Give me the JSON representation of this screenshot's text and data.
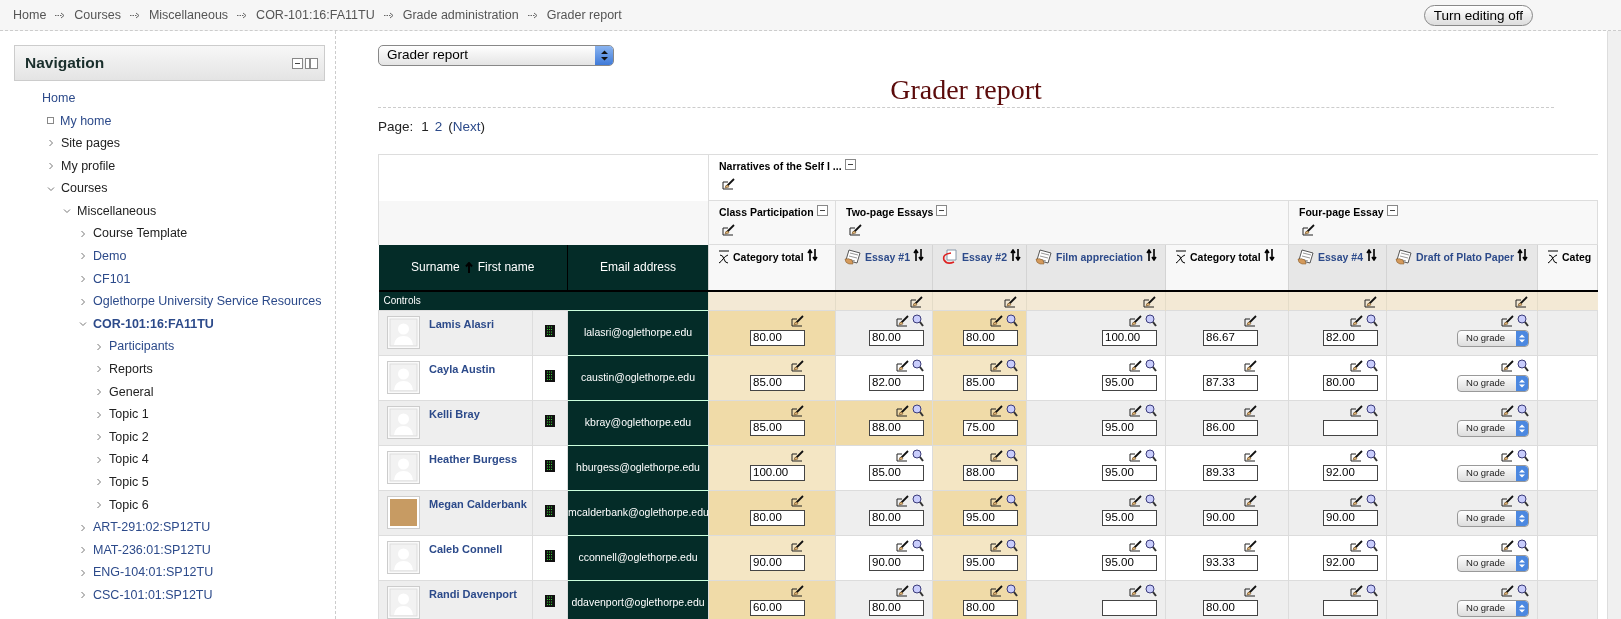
{
  "breadcrumb": [
    "Home",
    "Courses",
    "Miscellaneous",
    "COR-101:16:FA11TU",
    "Grade administration",
    "Grader report"
  ],
  "edit_button": "Turn editing off",
  "nav": {
    "title": "Navigation",
    "items": [
      {
        "label": "Home",
        "kind": "root",
        "link": true,
        "current": false
      },
      {
        "label": "My home",
        "kind": "leaf",
        "link": true,
        "current": false
      },
      {
        "label": "Site pages",
        "kind": "branch",
        "link": false,
        "current": false,
        "expanded": false
      },
      {
        "label": "My profile",
        "kind": "branch",
        "link": false,
        "current": false,
        "expanded": false
      },
      {
        "label": "Courses",
        "kind": "branch",
        "link": false,
        "current": false,
        "expanded": true,
        "children": [
          {
            "label": "Miscellaneous",
            "kind": "branch",
            "link": false,
            "current": false,
            "expanded": true,
            "children": [
              {
                "label": "Course Template",
                "kind": "branch",
                "link": false,
                "current": false,
                "expanded": false
              },
              {
                "label": "Demo",
                "kind": "branch",
                "link": true,
                "current": false,
                "expanded": false
              },
              {
                "label": "CF101",
                "kind": "branch",
                "link": true,
                "current": false,
                "expanded": false
              },
              {
                "label": "Oglethorpe University Service Resources",
                "kind": "branch",
                "link": true,
                "current": false,
                "expanded": false
              },
              {
                "label": "COR-101:16:FA11TU",
                "kind": "branch",
                "link": true,
                "current": true,
                "expanded": true,
                "children": [
                  {
                    "label": "Participants",
                    "kind": "branch",
                    "link": true,
                    "current": false,
                    "expanded": false
                  },
                  {
                    "label": "Reports",
                    "kind": "branch",
                    "link": false,
                    "current": false,
                    "expanded": false
                  },
                  {
                    "label": "General",
                    "kind": "branch",
                    "link": false,
                    "current": false,
                    "expanded": false
                  },
                  {
                    "label": "Topic 1",
                    "kind": "branch",
                    "link": false,
                    "current": false,
                    "expanded": false
                  },
                  {
                    "label": "Topic 2",
                    "kind": "branch",
                    "link": false,
                    "current": false,
                    "expanded": false
                  },
                  {
                    "label": "Topic 4",
                    "kind": "branch",
                    "link": false,
                    "current": false,
                    "expanded": false
                  },
                  {
                    "label": "Topic 5",
                    "kind": "branch",
                    "link": false,
                    "current": false,
                    "expanded": false
                  },
                  {
                    "label": "Topic 6",
                    "kind": "branch",
                    "link": false,
                    "current": false,
                    "expanded": false
                  }
                ]
              },
              {
                "label": "ART-291:02:SP12TU",
                "kind": "branch",
                "link": true,
                "current": false,
                "expanded": false
              },
              {
                "label": "MAT-236:01:SP12TU",
                "kind": "branch",
                "link": true,
                "current": false,
                "expanded": false
              },
              {
                "label": "ENG-104:01:SP12TU",
                "kind": "branch",
                "link": true,
                "current": false,
                "expanded": false
              },
              {
                "label": "CSC-101:01:SP12TU",
                "kind": "branch",
                "link": true,
                "current": false,
                "expanded": false
              }
            ]
          }
        ]
      }
    ]
  },
  "report_select": "Grader report",
  "title": "Grader report",
  "pager": {
    "label": "Page:",
    "pages": [
      {
        "label": "1",
        "selected": true
      },
      {
        "label": "2",
        "selected": false
      }
    ],
    "open": "(",
    "next": "Next",
    "close": ")"
  },
  "grader": {
    "category": "Narratives of the Self I ...",
    "surname": "Surname",
    "first_name": "First name",
    "email": "Email address",
    "controls": "Controls",
    "subcategories": [
      {
        "label": "Class Participation",
        "columns": [
          {
            "label": "Category total",
            "kind": "total",
            "sort": true
          }
        ]
      },
      {
        "label": "Two-page Essays",
        "columns": [
          {
            "label": "Essay #1",
            "kind": "assignment",
            "sort": true
          },
          {
            "label": "Essay #2",
            "kind": "external",
            "sort": true
          },
          {
            "label": "Film appreciation",
            "kind": "assignment",
            "sort": true
          },
          {
            "label": "Category total",
            "kind": "total",
            "sort": true
          }
        ]
      },
      {
        "label": "Four-page Essay",
        "columns": [
          {
            "label": "Essay #4",
            "kind": "assignment",
            "sort": true
          },
          {
            "label": "Draft of Plato Paper",
            "kind": "assignment",
            "sort": true
          },
          {
            "label": "Categ",
            "kind": "total",
            "sort": false
          }
        ]
      }
    ],
    "students": [
      {
        "name": "Lamis Alasri",
        "email": "lalasri@oglethorpe.edu",
        "kind": "silhouette",
        "grades": [
          {
            "value": "80.00",
            "highlighted": true
          },
          {
            "value": "80.00",
            "highlighted": false
          },
          {
            "value": "80.00",
            "highlighted": true
          },
          {
            "value": "100.00",
            "highlighted": false
          },
          {
            "value": "86.67",
            "highlighted": false
          },
          {
            "value": "82.00",
            "highlighted": false
          },
          {
            "select": "No grade",
            "highlighted": false
          }
        ]
      },
      {
        "name": "Cayla Austin",
        "email": "caustin@oglethorpe.edu",
        "kind": "silhouette",
        "grades": [
          {
            "value": "85.00",
            "highlighted": true
          },
          {
            "value": "82.00",
            "highlighted": false
          },
          {
            "value": "85.00",
            "highlighted": true
          },
          {
            "value": "95.00",
            "highlighted": false
          },
          {
            "value": "87.33",
            "highlighted": false
          },
          {
            "value": "80.00",
            "highlighted": false
          },
          {
            "select": "No grade",
            "highlighted": false
          }
        ]
      },
      {
        "name": "Kelli Bray",
        "email": "kbray@oglethorpe.edu",
        "kind": "silhouette",
        "grades": [
          {
            "value": "85.00",
            "highlighted": true
          },
          {
            "value": "88.00",
            "highlighted": true
          },
          {
            "value": "75.00",
            "highlighted": true
          },
          {
            "value": "95.00",
            "highlighted": false
          },
          {
            "value": "86.00",
            "highlighted": false
          },
          {
            "highlighted": false
          },
          {
            "select": "No grade",
            "highlighted": false
          }
        ]
      },
      {
        "name": "Heather Burgess",
        "email": "hburgess@oglethorpe.edu",
        "kind": "silhouette",
        "grades": [
          {
            "value": "100.00",
            "highlighted": true
          },
          {
            "value": "85.00",
            "highlighted": false
          },
          {
            "value": "88.00",
            "highlighted": true
          },
          {
            "value": "95.00",
            "highlighted": false
          },
          {
            "value": "89.33",
            "highlighted": false
          },
          {
            "value": "92.00",
            "highlighted": false
          },
          {
            "select": "No grade",
            "highlighted": false
          }
        ]
      },
      {
        "name": "Megan Calderbank",
        "email": "mcalderbank@oglethorpe.edu",
        "kind": "photo",
        "grades": [
          {
            "value": "80.00",
            "highlighted": true
          },
          {
            "value": "80.00",
            "highlighted": false
          },
          {
            "value": "95.00",
            "highlighted": true
          },
          {
            "value": "95.00",
            "highlighted": false
          },
          {
            "value": "90.00",
            "highlighted": false
          },
          {
            "value": "90.00",
            "highlighted": false
          },
          {
            "select": "No grade",
            "highlighted": false
          }
        ]
      },
      {
        "name": "Caleb Connell",
        "email": "cconnell@oglethorpe.edu",
        "kind": "silhouette",
        "grades": [
          {
            "value": "90.00",
            "highlighted": true
          },
          {
            "value": "90.00",
            "highlighted": false
          },
          {
            "value": "95.00",
            "highlighted": true
          },
          {
            "value": "95.00",
            "highlighted": false
          },
          {
            "value": "93.33",
            "highlighted": false
          },
          {
            "value": "92.00",
            "highlighted": false
          },
          {
            "select": "No grade",
            "highlighted": false
          }
        ]
      },
      {
        "name": "Randi Davenport",
        "email": "ddavenport@oglethorpe.edu",
        "kind": "silhouette",
        "grades": [
          {
            "value": "60.00",
            "highlighted": true
          },
          {
            "value": "80.00",
            "highlighted": false
          },
          {
            "value": "80.00",
            "highlighted": true
          },
          {
            "highlighted": false
          },
          {
            "value": "80.00",
            "highlighted": false
          },
          {
            "highlighted": false
          },
          {
            "select": "No grade",
            "highlighted": false
          }
        ]
      }
    ]
  }
}
